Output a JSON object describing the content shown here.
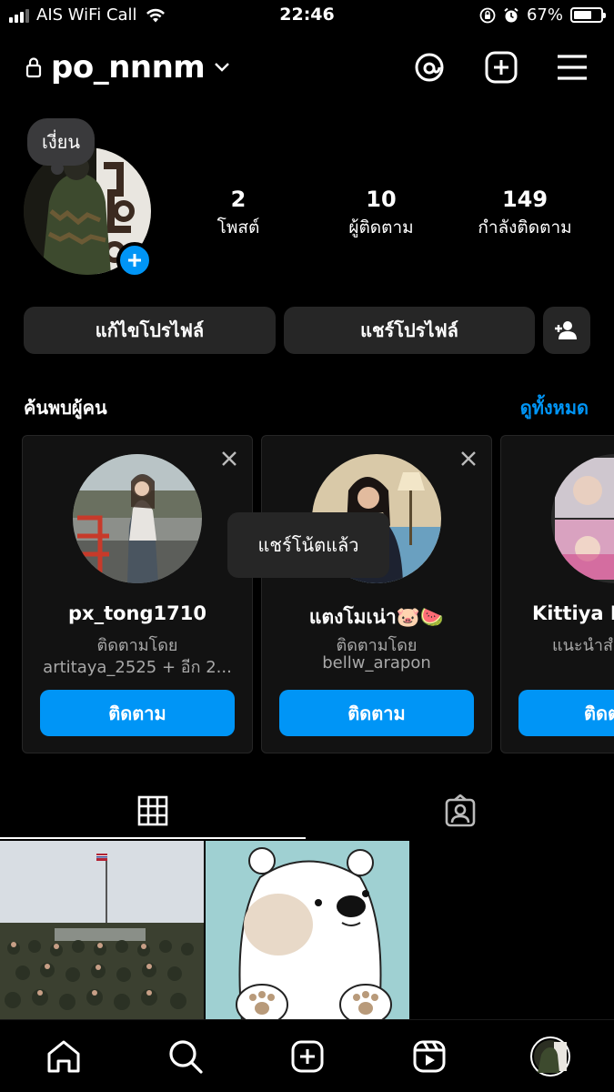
{
  "status_bar": {
    "carrier": "AIS WiFi Call",
    "time": "22:46",
    "battery": "67%",
    "battery_level": 0.67
  },
  "header": {
    "username": "po_nnnm",
    "icons": [
      "lock-icon",
      "chevron-down-icon",
      "threads-icon",
      "new-post-icon",
      "menu-icon"
    ]
  },
  "profile": {
    "note": "เงี่ยน",
    "stats": [
      {
        "value": "2",
        "label": "โพสต์"
      },
      {
        "value": "10",
        "label": "ผู้ติดตาม"
      },
      {
        "value": "149",
        "label": "กำลังติดตาม"
      }
    ]
  },
  "actions": {
    "edit_profile": "แก้ไขโปรไฟล์",
    "share_profile": "แชร์โปรไฟล์"
  },
  "discover": {
    "title": "ค้นพบผู้คน",
    "see_all": "ดูทั้งหมด",
    "cards": [
      {
        "name": "px_tong1710",
        "line1": "ติดตามโดย",
        "line2": "artitaya_2525 + อีก  2...",
        "follow": "ติดตาม"
      },
      {
        "name": "แตงโมเน่า🐷🍉",
        "line1": "ติดตามโดย",
        "line2": "bellw_arapon",
        "follow": "ติดตาม"
      },
      {
        "name": "Kittiya L",
        "line1": "แนะนำสำ",
        "line2": "",
        "follow": "ติดต"
      }
    ]
  },
  "toast": "แชร์โน้ตแล้ว",
  "tabs": [
    "grid-icon",
    "tagged-icon"
  ],
  "bottom_nav": [
    "home-icon",
    "search-icon",
    "create-icon",
    "reels-icon",
    "profile-avatar"
  ],
  "colors": {
    "accent": "#0095f6",
    "button_bg": "#262626",
    "background": "#000000"
  }
}
